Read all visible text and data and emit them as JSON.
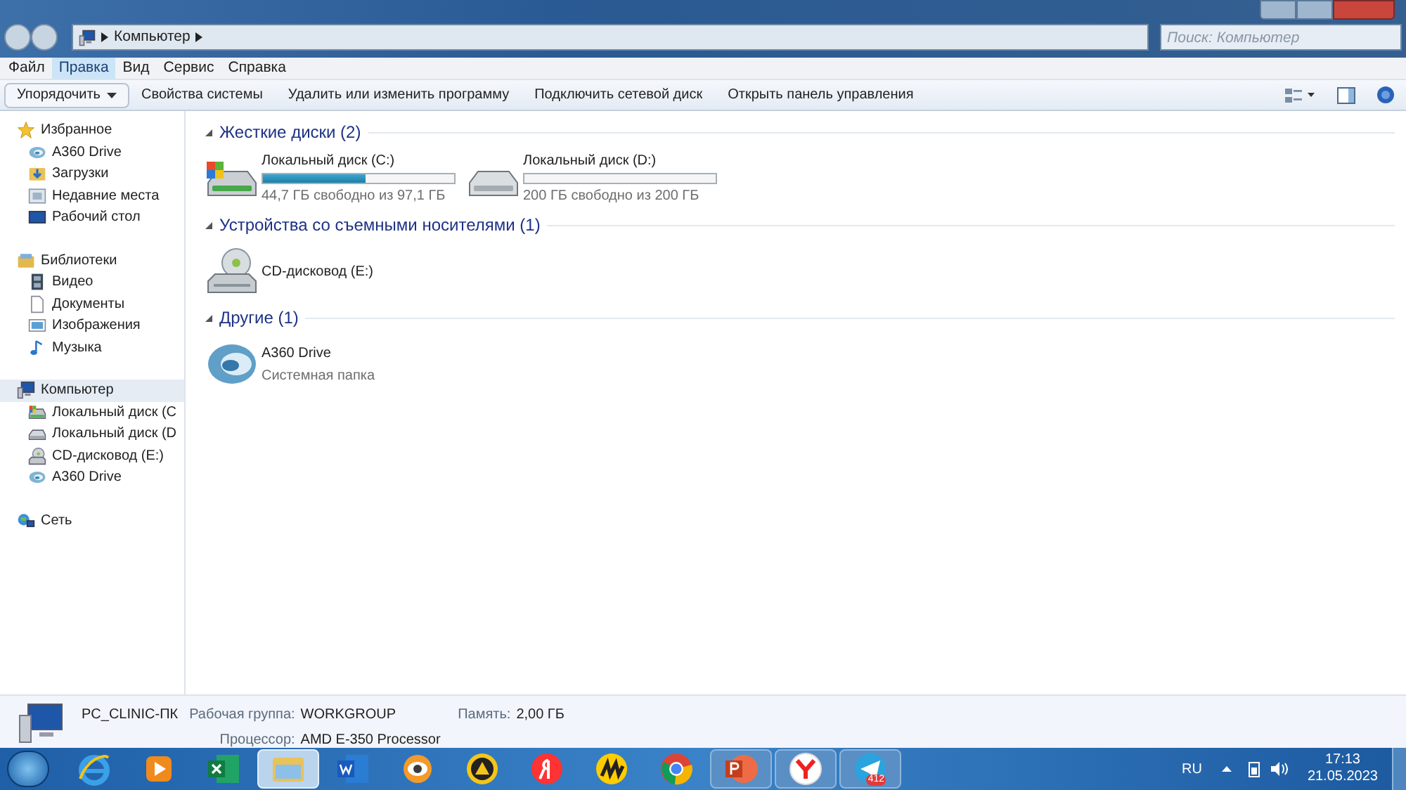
{
  "window": {
    "breadcrumb": "Компьютер",
    "search": {
      "placeholder": "Поиск: Компьютер"
    }
  },
  "menu": [
    {
      "label": "Файл",
      "selected": false
    },
    {
      "label": "Правка",
      "selected": true
    },
    {
      "label": "Вид",
      "selected": false
    },
    {
      "label": "Сервис",
      "selected": false
    },
    {
      "label": "Справка",
      "selected": false
    }
  ],
  "toolbar": {
    "organize": "Упорядочить",
    "actions": [
      "Свойства системы",
      "Удалить или изменить программу",
      "Подключить сетевой диск",
      "Открыть панель управления"
    ]
  },
  "sidebar": [
    {
      "label": "Избранное",
      "kind": "star",
      "selected": false,
      "children": [
        {
          "label": "A360 Drive",
          "kind": "a360",
          "selected": false
        },
        {
          "label": "Загрузки",
          "kind": "downloads",
          "selected": false
        },
        {
          "label": "Недавние места",
          "kind": "recent",
          "selected": false
        },
        {
          "label": "Рабочий стол",
          "kind": "desktop",
          "selected": false
        }
      ]
    },
    {
      "label": "Библиотеки",
      "kind": "library",
      "selected": false,
      "children": [
        {
          "label": "Видео",
          "kind": "video",
          "selected": false
        },
        {
          "label": "Документы",
          "kind": "documents",
          "selected": false
        },
        {
          "label": "Изображения",
          "kind": "images",
          "selected": false
        },
        {
          "label": "Музыка",
          "kind": "music",
          "selected": false
        }
      ]
    },
    {
      "label": "Компьютер",
      "kind": "computer",
      "selected": true,
      "children": [
        {
          "label": "Локальный диск (C",
          "kind": "drive-win",
          "selected": false
        },
        {
          "label": "Локальный диск (D",
          "kind": "drive",
          "selected": false
        },
        {
          "label": "CD-дисковод (E:)",
          "kind": "cd",
          "selected": false
        },
        {
          "label": "A360 Drive",
          "kind": "a360",
          "selected": false
        }
      ]
    },
    {
      "label": "Сеть",
      "kind": "network",
      "selected": false
    }
  ],
  "groups": [
    {
      "title": "Жесткие диски (2)",
      "items": [
        {
          "name": "Локальный диск (C:)",
          "kind": "drive-win",
          "level": 0.54,
          "info": "44,7 ГБ свободно из 97,1 ГБ"
        },
        {
          "name": "Локальный диск (D:)",
          "kind": "drive",
          "info": "200 ГБ свободно из 200 ГБ"
        }
      ]
    },
    {
      "title": "Устройства со съемными носителями (1)",
      "items": [
        {
          "name": "CD-дисковод (E:)",
          "kind": "cd"
        }
      ]
    },
    {
      "title": "Другие (1)",
      "items": [
        {
          "name": "A360 Drive",
          "kind": "a360",
          "info": "Системная папка"
        }
      ]
    }
  ],
  "details": {
    "computer_name": "PC_CLINIC-ПК",
    "fields": [
      {
        "label": "Рабочая группа:",
        "value": "WORKGROUP"
      },
      {
        "label": "Память:",
        "value": "2,00 ГБ"
      },
      {
        "label": "Процессор:",
        "value": "AMD E-350 Processor"
      }
    ]
  },
  "taskbar": {
    "apps": [
      {
        "kind": "ie",
        "selected": false
      },
      {
        "kind": "player",
        "selected": false
      },
      {
        "kind": "excel",
        "selected": false
      },
      {
        "kind": "explorer",
        "selected": true
      },
      {
        "kind": "word",
        "selected": false
      },
      {
        "kind": "eye",
        "selected": false
      },
      {
        "kind": "triangle",
        "selected": false
      },
      {
        "kind": "yandex",
        "selected": false
      },
      {
        "kind": "market",
        "selected": false
      },
      {
        "kind": "chrome",
        "selected": false
      },
      {
        "kind": "powerpoint",
        "selected": false
      },
      {
        "kind": "ybrowser",
        "selected": false
      },
      {
        "kind": "telegram",
        "selected": false,
        "badge": "412"
      }
    ],
    "language": "RU",
    "time": "17:13",
    "date": "21.05.2023"
  }
}
